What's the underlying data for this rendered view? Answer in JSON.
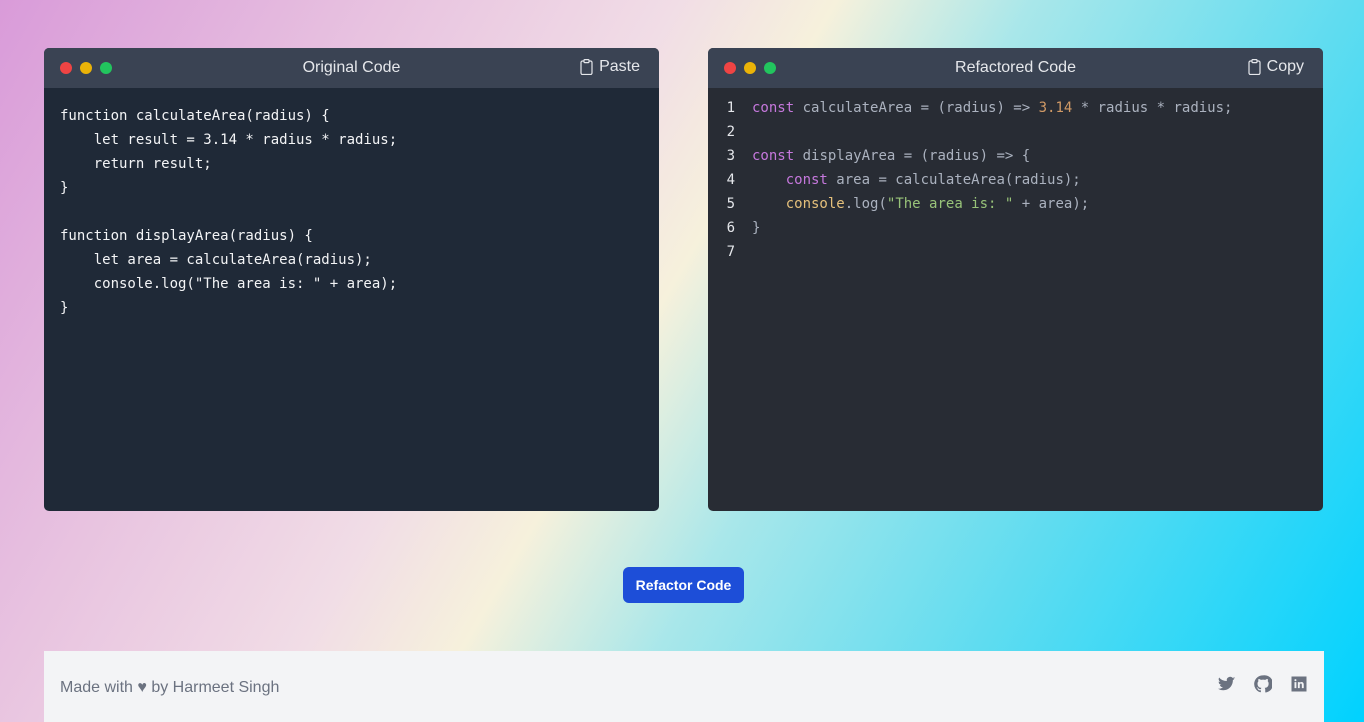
{
  "original": {
    "title": "Original Code",
    "paste_label": "Paste",
    "code": "function calculateArea(radius) {\n    let result = 3.14 * radius * radius;\n    return result;\n}\n\nfunction displayArea(radius) {\n    let area = calculateArea(radius);\n    console.log(\"The area is: \" + area);\n}"
  },
  "refactored": {
    "title": "Refactored Code",
    "copy_label": "Copy",
    "line_numbers": [
      "1",
      "2",
      "3",
      "4",
      "5",
      "6",
      "7"
    ],
    "lines": [
      [
        {
          "t": "kw",
          "v": "const"
        },
        {
          "t": "tx",
          "v": " calculateArea = (radius) => "
        },
        {
          "t": "num",
          "v": "3.14"
        },
        {
          "t": "tx",
          "v": " * radius * radius;"
        }
      ],
      [],
      [
        {
          "t": "kw",
          "v": "const"
        },
        {
          "t": "tx",
          "v": " displayArea = (radius) => {"
        }
      ],
      [
        {
          "t": "tx",
          "v": "    "
        },
        {
          "t": "kw",
          "v": "const"
        },
        {
          "t": "tx",
          "v": " area = calculateArea(radius);"
        }
      ],
      [
        {
          "t": "tx",
          "v": "    "
        },
        {
          "t": "obj",
          "v": "console"
        },
        {
          "t": "tx",
          "v": ".log("
        },
        {
          "t": "str",
          "v": "\"The area is: \""
        },
        {
          "t": "tx",
          "v": " + area);"
        }
      ],
      [
        {
          "t": "tx",
          "v": "}"
        }
      ],
      []
    ]
  },
  "refactor_button": "Refactor Code",
  "footer": {
    "made_by": "Made with ♥ by Harmeet Singh",
    "social_icons": [
      "twitter-icon",
      "github-icon",
      "linkedin-icon"
    ]
  },
  "colors": {
    "accent": "#1d4ed8",
    "editor_left_bg": "#1f2937",
    "editor_right_bg": "#282c34"
  }
}
